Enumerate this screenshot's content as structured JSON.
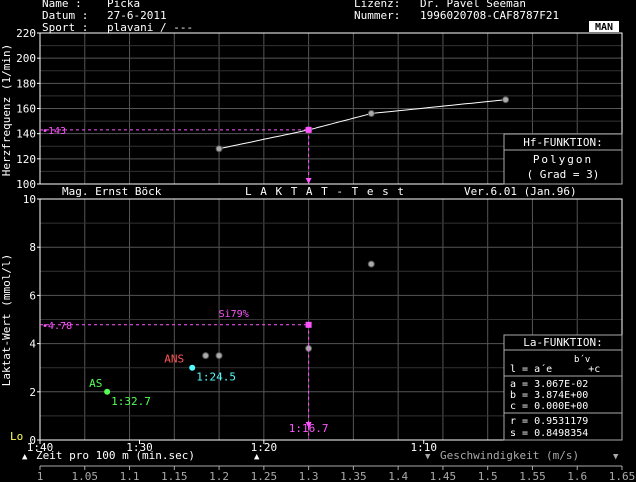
{
  "header": {
    "name_label": "Name   : ",
    "name_value": "Picka",
    "date_label": "Datum  : ",
    "date_value": "27-6-2011",
    "sport_label": "Sport  : ",
    "sport_value": "plavani / ---",
    "license_label": "Lizenz: ",
    "license_value": "Dr. Pavel Seeman",
    "number_label": "Nummer: ",
    "number_value": "1996020708-CAF8787F21",
    "man_button": "MAN"
  },
  "hf_panel": {
    "title": "Hf-FUNKTION:",
    "type": "Polygon",
    "degree": "( Grad = 3)"
  },
  "la_panel": {
    "title": "La-FUNKTION:",
    "formula_top": "b´v",
    "formula": "l = a´e      +c",
    "a": "a = 3.067E-02",
    "b": "b = 3.874E+00",
    "c": "c = 0.000E+00",
    "r": "r = 0.9531179",
    "s": "s = 0.8498354"
  },
  "middle_bar": {
    "left": "Mag. Ernst Böck",
    "center": "L A K T A T  -  T e s t",
    "right": "Ver.6.01 (Jan.96)"
  },
  "bottom_bar": {
    "time_axis": "Zeit pro 100 m (min.sec)",
    "speed_axis": "Geschwindigkeit (m/s)",
    "lo_label": "Lo",
    "up_arrow": "▲",
    "down_arrow": "▼"
  },
  "colors": {
    "magenta": "#ff55ff",
    "cyan": "#55ffff",
    "green": "#55ff55",
    "red": "#ff5555",
    "grid": "#555555",
    "gray": "#aaaaaa"
  },
  "chart_data": [
    {
      "type": "line",
      "ylabel": "Herzfrequenz (1/min)",
      "ylim": [
        100,
        220
      ],
      "yticks": [
        "100",
        "120",
        "140",
        "160",
        "180",
        "200",
        "220"
      ],
      "xlim": [
        1.0,
        1.65
      ],
      "points": [
        [
          1.2,
          128
        ],
        [
          1.3,
          143
        ],
        [
          1.37,
          156
        ],
        [
          1.52,
          167
        ]
      ],
      "marker": {
        "x": 1.3,
        "y": 143,
        "label": "143"
      },
      "grid": true
    },
    {
      "type": "scatter",
      "ylabel": "Laktat-Wert (mmol/l)",
      "ylim": [
        0,
        10
      ],
      "yticks": [
        "0",
        "2",
        "4",
        "6",
        "8",
        "10"
      ],
      "xlim": [
        1.0,
        1.65
      ],
      "x_speed_ticks": [
        "1",
        "1.05",
        "1.1",
        "1.15",
        "1.2",
        "1.25",
        "1.3",
        "1.35",
        "1.4",
        "1.45",
        "1.5",
        "1.55",
        "1.6",
        "1.65"
      ],
      "x_time_ticks": [
        "1:40",
        "1:30",
        "1:20",
        "1:10"
      ],
      "measured_points": [
        [
          1.185,
          3.5
        ],
        [
          1.2,
          3.5
        ],
        [
          1.3,
          3.8
        ],
        [
          1.37,
          7.3
        ]
      ],
      "fit_curve": {
        "a": 0.03067,
        "b": 3.874,
        "c": 0
      },
      "annotations": [
        {
          "label": "AS",
          "x": 1.075,
          "y": 2.0,
          "time": "1:32.7"
        },
        {
          "label": "ANS",
          "x": 1.17,
          "y": 3.0,
          "time": "1:24.5"
        },
        {
          "label": "Si79%",
          "x": 1.3,
          "y": 4.78,
          "time": "1:16.7",
          "value": "4.78"
        }
      ],
      "grid": true
    }
  ]
}
